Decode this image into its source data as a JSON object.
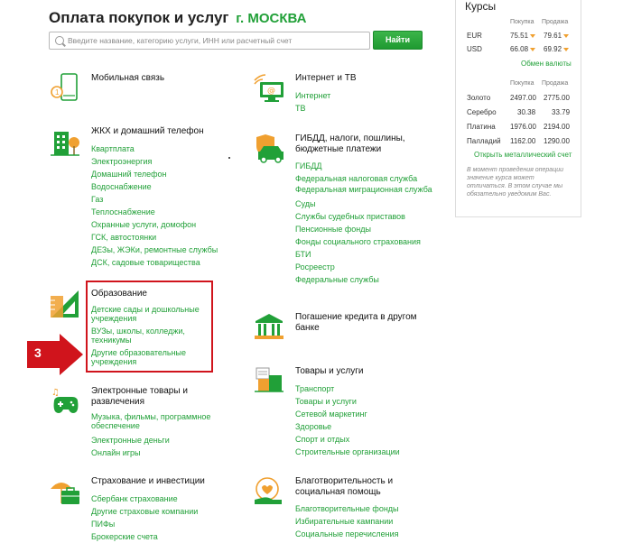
{
  "header": {
    "title": "Оплата покупок и услуг",
    "city": "г. МОСКВА"
  },
  "search": {
    "placeholder": "Введите название, категорию услуги, ИНН или расчетный счет",
    "button": "Найти"
  },
  "categories_left": [
    {
      "title": "Мобильная связь",
      "icon": "smartphone-icon",
      "links": []
    },
    {
      "title": "ЖКХ и домашний телефон",
      "icon": "house-icon",
      "links": [
        "Квартплата",
        "Электроэнергия",
        "Домашний телефон",
        "Водоснабжение",
        "Газ",
        "Теплоснабжение",
        "Охранные услуги, домофон",
        "ГСК, автостоянки",
        "ДЕЗы, ЖЭКи, ремонтные службы",
        "ДСК, садовые товарищества"
      ]
    },
    {
      "title": "Образование",
      "icon": "ruler-triangle-icon",
      "links": [
        "Детские сады и дошкольные учреждения",
        "ВУЗы, школы, колледжи, техникумы",
        "Другие образовательные учреждения"
      ]
    },
    {
      "title": "Электронные товары и развлечения",
      "icon": "gamepad-icon",
      "links": [
        "Музыка, фильмы, программное обеспечение",
        "Электронные деньги",
        "Онлайн игры"
      ]
    },
    {
      "title": "Страхование и инвестиции",
      "icon": "umbrella-icon",
      "links": [
        "Сбербанк страхование",
        "Другие страховые компании",
        "ПИФы",
        "Брокерские счета"
      ]
    }
  ],
  "categories_right": [
    {
      "title": "Интернет и ТВ",
      "icon": "monitor-wifi-icon",
      "links": [
        "Интернет",
        "ТВ"
      ]
    },
    {
      "title": "ГИБДД, налоги, пошлины, бюджетные платежи",
      "icon": "car-shield-icon",
      "links": [
        "ГИБДД",
        "Федеральная налоговая служба",
        "Федеральная миграционная служба",
        "Суды",
        "Службы судебных приставов",
        "Пенсионные фонды",
        "Фонды социального страхования",
        "БТИ",
        "Росреестр",
        "Федеральные службы"
      ]
    },
    {
      "title": "Погашение кредита в другом банке",
      "icon": "bank-icon",
      "links": []
    },
    {
      "title": "Товары и услуги",
      "icon": "shopping-cart-icon",
      "links": [
        "Транспорт",
        "Товары и услуги",
        "Сетевой маркетинг",
        "Здоровье",
        "Спорт и отдых",
        "Строительные организации"
      ]
    },
    {
      "title": "Благотворительность и социальная помощь",
      "icon": "charity-hands-icon",
      "links": [
        "Благотворительные фонды",
        "Избирательные кампании",
        "Социальные перечисления"
      ]
    }
  ],
  "annotation": {
    "step": "3",
    "color": "#d0141c"
  },
  "rates": {
    "title": "Курсы",
    "col_buy": "Покупка",
    "col_sell": "Продажа",
    "currencies": [
      {
        "name": "EUR",
        "buy": "75.51",
        "sell": "79.61"
      },
      {
        "name": "USD",
        "buy": "66.08",
        "sell": "69.92"
      }
    ],
    "currency_link": "Обмен валюты",
    "metals": [
      {
        "name": "Золото",
        "buy": "2497.00",
        "sell": "2775.00"
      },
      {
        "name": "Серебро",
        "buy": "30.38",
        "sell": "33.79"
      },
      {
        "name": "Платина",
        "buy": "1976.00",
        "sell": "2194.00"
      },
      {
        "name": "Палладий",
        "buy": "1162.00",
        "sell": "1290.00"
      }
    ],
    "metal_link": "Открыть металлический счет",
    "note": "В момент проведения операции значение курса может отличаться. В этом случае мы обязательно уведомим Вас."
  },
  "colors": {
    "brand_green": "#21a038",
    "accent_orange": "#f0a030"
  }
}
